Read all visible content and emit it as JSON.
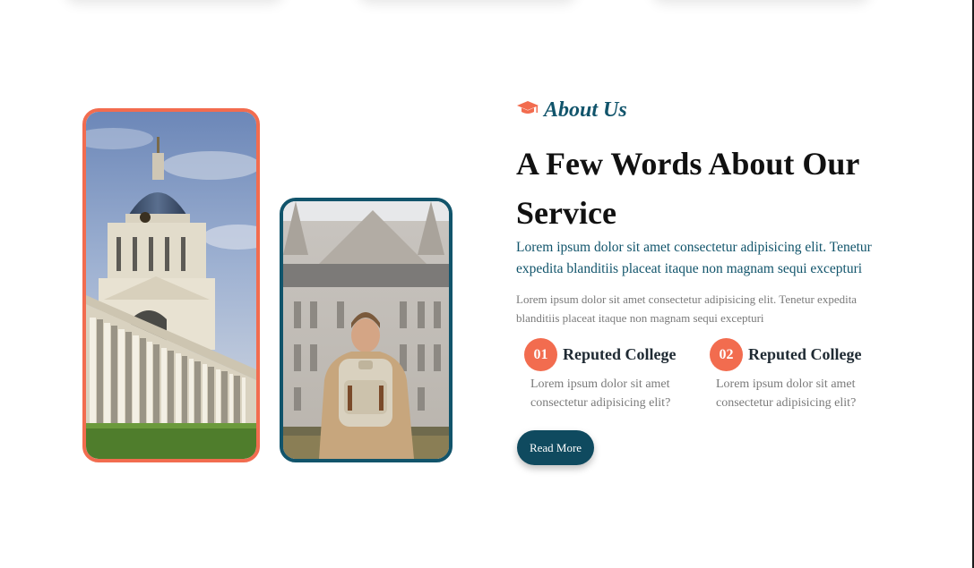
{
  "about": {
    "eyebrow": "About Us",
    "heading": "A Few Words About Our Service",
    "lead": "Lorem ipsum dolor sit amet consectetur adipisicing elit. Tenetur expedita blanditiis placeat itaque non magnam sequi excepturi",
    "body": "Lorem ipsum dolor sit amet consectetur adipisicing elit. Tenetur expedita blanditiis placeat itaque non magnam sequi excepturi",
    "features": [
      {
        "number": "01",
        "title": "Reputed College",
        "desc": "Lorem ipsum dolor sit amet consectetur adipisicing elit?"
      },
      {
        "number": "02",
        "title": "Reputed College",
        "desc": "Lorem ipsum dolor sit amet consectetur adipisicing elit?"
      }
    ],
    "button_label": "Read More"
  },
  "icons": {
    "eyebrow_icon": "graduation-cap-icon"
  },
  "colors": {
    "accent": "#f26c4f",
    "primary": "#11546b",
    "button": "#0f4a5f",
    "muted_text": "#7a7a7a"
  }
}
